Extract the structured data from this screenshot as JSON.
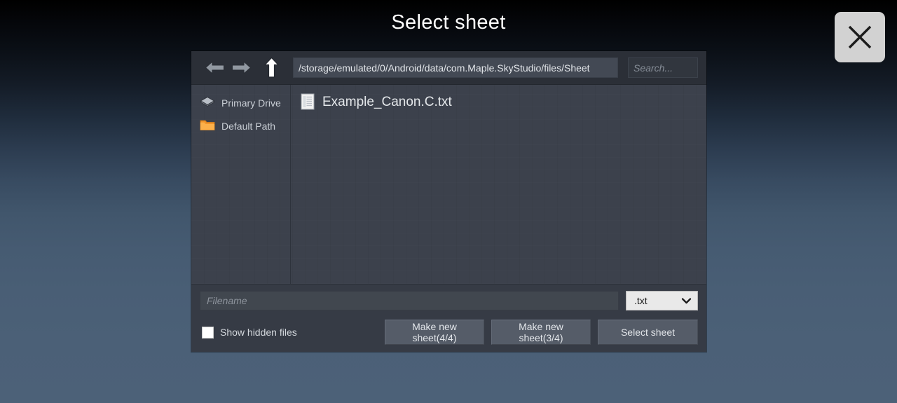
{
  "overlay": {
    "title": "Select sheet",
    "close_icon": "close-x-icon"
  },
  "toolbar": {
    "back_icon": "arrow-left-icon",
    "forward_icon": "arrow-right-icon",
    "up_icon": "arrow-up-icon",
    "path_value": "/storage/emulated/0/Android/data/com.Maple.SkyStudio/files/Sheet",
    "search_placeholder": "Search..."
  },
  "sidebar": {
    "items": [
      {
        "label": "Primary Drive",
        "icon": "drive-icon"
      },
      {
        "label": "Default Path",
        "icon": "folder-icon"
      }
    ]
  },
  "file_list": {
    "files": [
      {
        "name": "Example_Canon.C.txt",
        "icon": "text-file-icon"
      }
    ]
  },
  "footer": {
    "filename_placeholder": "Filename",
    "extension_selected": ".txt",
    "extension_chevron": "chevron-down-icon",
    "show_hidden_label": "Show hidden files",
    "show_hidden_checked": false,
    "buttons": [
      {
        "label": "Make new sheet(4/4)"
      },
      {
        "label": "Make new sheet(3/4)"
      },
      {
        "label": "Select sheet"
      }
    ]
  },
  "colors": {
    "dialog_bg": "#383e49",
    "toolbar_bg": "#2b2f37",
    "list_bg": "#3c414c",
    "button_bg": "#555c68",
    "folder_accent": "#f0942a",
    "select_bg": "#e9e9e9"
  }
}
